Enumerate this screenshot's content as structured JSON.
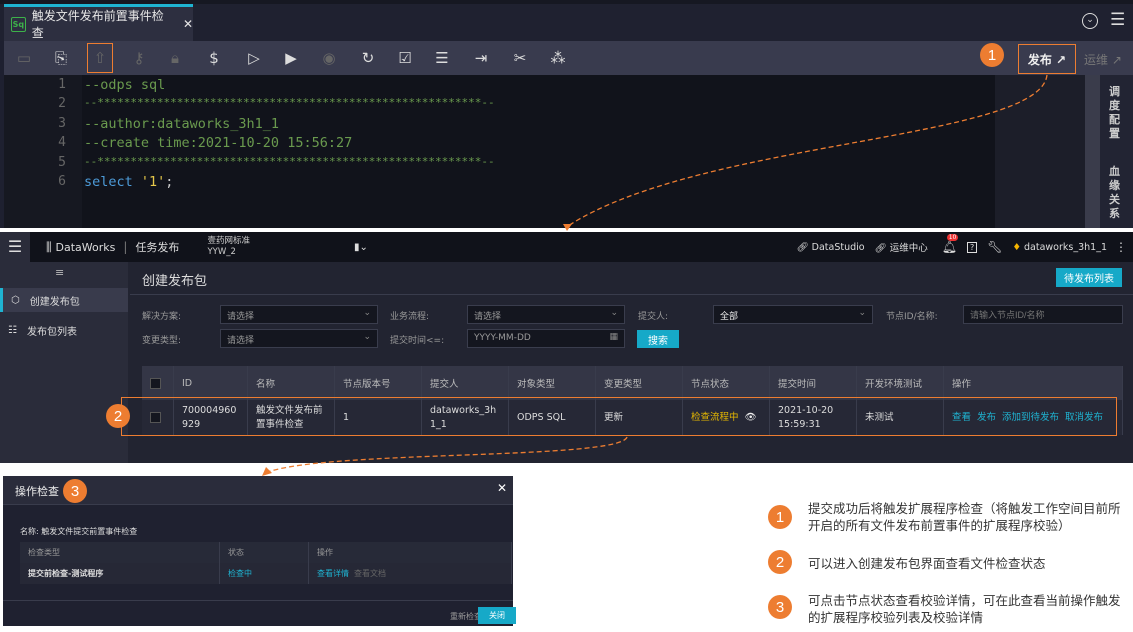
{
  "editor": {
    "tab_title": "触发文件发布前置事件检查",
    "tab_icon": "Sq",
    "toolbar_icons": [
      "save-icon",
      "save-as-icon",
      "submit-icon",
      "key-icon",
      "lock-icon",
      "cost-icon",
      "run-icon",
      "run-params-icon",
      "stop-icon",
      "reload-icon",
      "format-check-icon",
      "format-icon",
      "pre-run-icon",
      "tools-icon",
      "lineage-icon"
    ],
    "publish_label": "发布 ↗",
    "ops_label": "运维 ↗",
    "lines": [
      {
        "n": "1",
        "text": "--odps sql"
      },
      {
        "n": "2",
        "text": "--**********************************************************--"
      },
      {
        "n": "3",
        "text": "--author:dataworks_3h1_1"
      },
      {
        "n": "4",
        "text": "--create time:2021-10-20 15:56:27"
      },
      {
        "n": "5",
        "text": "--**********************************************************--"
      },
      {
        "n": "6",
        "kw": "select ",
        "str": "'1'",
        "end": ";"
      }
    ],
    "side_tabs": [
      "调度配置",
      "血缘关系"
    ]
  },
  "dataworks": {
    "brand": "DataWorks",
    "module": "任务发布",
    "workspace": "壹药网标准",
    "workspace_id": "YYW_2",
    "nav": {
      "datastudio": "DataStudio",
      "ops": "运维中心",
      "notif_count": "10",
      "user": "dataworks_3h1_1"
    },
    "sidebar": [
      {
        "label": "创建发布包",
        "active": true
      },
      {
        "label": "发布包列表"
      }
    ],
    "page_title": "创建发布包",
    "pending_btn": "待发布列表",
    "filters": {
      "solution": {
        "label": "解决方案:",
        "value": "请选择"
      },
      "flow": {
        "label": "业务流程:",
        "value": "请选择"
      },
      "submitter": {
        "label": "提交人:",
        "value": "全部"
      },
      "node": {
        "label": "节点ID/名称:",
        "placeholder": "请输入节点ID/名称"
      },
      "change": {
        "label": "变更类型:",
        "value": "请选择"
      },
      "time": {
        "label": "提交时间<=:",
        "placeholder": "YYYY-MM-DD"
      },
      "search": "搜索"
    },
    "table": {
      "headers": [
        "ID",
        "名称",
        "节点版本号",
        "提交人",
        "对象类型",
        "变更类型",
        "节点状态",
        "提交时间",
        "开发环境测试",
        "操作"
      ],
      "row": {
        "id": "700004960 929",
        "name": "触发文件发布前置事件检查",
        "version": "1",
        "submitter": "dataworks_3h1_1",
        "type": "ODPS SQL",
        "change": "更新",
        "status": "检查流程中",
        "time": "2021-10-20 15:59:31",
        "test": "未测试",
        "actions": [
          "查看",
          "发布",
          "添加到待发布",
          "取消发布"
        ]
      }
    },
    "status_color": "#e6b800",
    "accent": "#16a9c8"
  },
  "dialog": {
    "title": "操作检查",
    "name_label": "名称: 触发文件提交前置事件检查",
    "headers": [
      "检查类型",
      "状态",
      "操作"
    ],
    "row": {
      "type": "提交前检查-测试程序",
      "status": "检查中",
      "view": "查看详情",
      "doc": "查看文档"
    },
    "recheck": "重新检查",
    "close": "关闭"
  },
  "callouts": [
    {
      "n": "1",
      "text": "提交成功后将触发扩展程序检查（将触发工作空间目前所开启的所有文件发布前置事件的扩展程序校验）"
    },
    {
      "n": "2",
      "text": "可以进入创建发布包界面查看文件检查状态"
    },
    {
      "n": "3",
      "text": "可点击节点状态查看校验详情，可在此查看当前操作触发的扩展程序校验列表及校验详情"
    }
  ],
  "highlight_color": "#ed7d31"
}
